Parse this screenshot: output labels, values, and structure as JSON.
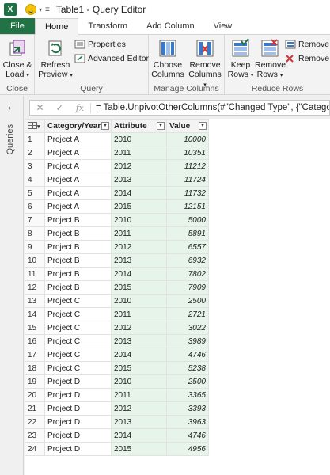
{
  "window": {
    "title": "Table1 - Query Editor"
  },
  "tabs": [
    {
      "label": "File"
    },
    {
      "label": "Home"
    },
    {
      "label": "Transform"
    },
    {
      "label": "Add Column"
    },
    {
      "label": "View"
    }
  ],
  "ribbon": {
    "close": {
      "label1": "Close &",
      "label2": "Load",
      "group": "Close"
    },
    "query": {
      "refresh1": "Refresh",
      "refresh2": "Preview",
      "properties": "Properties",
      "advanced": "Advanced Editor",
      "group": "Query"
    },
    "manage": {
      "choose1": "Choose",
      "choose2": "Columns",
      "remove1": "Remove",
      "remove2": "Columns",
      "group": "Manage Columns"
    },
    "reduce": {
      "keep1": "Keep",
      "keep2": "Rows",
      "remove1": "Remove",
      "remove2": "Rows",
      "removeDup": "Remove Du",
      "removeErr": "Remove Er",
      "group": "Reduce Rows"
    }
  },
  "sidepane": {
    "label": "Queries"
  },
  "formula": {
    "text": "= Table.UnpivotOtherColumns(#\"Changed Type\", {\"Category"
  },
  "columns": [
    "Category/Year",
    "Attribute",
    "Value"
  ],
  "rows": [
    [
      "1",
      "Project A",
      "2010",
      "10000"
    ],
    [
      "2",
      "Project A",
      "2011",
      "10351"
    ],
    [
      "3",
      "Project A",
      "2012",
      "11212"
    ],
    [
      "4",
      "Project A",
      "2013",
      "11724"
    ],
    [
      "5",
      "Project A",
      "2014",
      "11732"
    ],
    [
      "6",
      "Project A",
      "2015",
      "12151"
    ],
    [
      "7",
      "Project B",
      "2010",
      "5000"
    ],
    [
      "8",
      "Project B",
      "2011",
      "5891"
    ],
    [
      "9",
      "Project B",
      "2012",
      "6557"
    ],
    [
      "10",
      "Project B",
      "2013",
      "6932"
    ],
    [
      "11",
      "Project B",
      "2014",
      "7802"
    ],
    [
      "12",
      "Project B",
      "2015",
      "7909"
    ],
    [
      "13",
      "Project C",
      "2010",
      "2500"
    ],
    [
      "14",
      "Project C",
      "2011",
      "2721"
    ],
    [
      "15",
      "Project C",
      "2012",
      "3022"
    ],
    [
      "16",
      "Project C",
      "2013",
      "3989"
    ],
    [
      "17",
      "Project C",
      "2014",
      "4746"
    ],
    [
      "18",
      "Project C",
      "2015",
      "5238"
    ],
    [
      "19",
      "Project D",
      "2010",
      "2500"
    ],
    [
      "20",
      "Project D",
      "2011",
      "3365"
    ],
    [
      "21",
      "Project D",
      "2012",
      "3393"
    ],
    [
      "22",
      "Project D",
      "2013",
      "3963"
    ],
    [
      "23",
      "Project D",
      "2014",
      "4746"
    ],
    [
      "24",
      "Project D",
      "2015",
      "4956"
    ]
  ],
  "colors": {
    "excelGreen": "#217346",
    "selectedCol": "#e6f4ea"
  }
}
